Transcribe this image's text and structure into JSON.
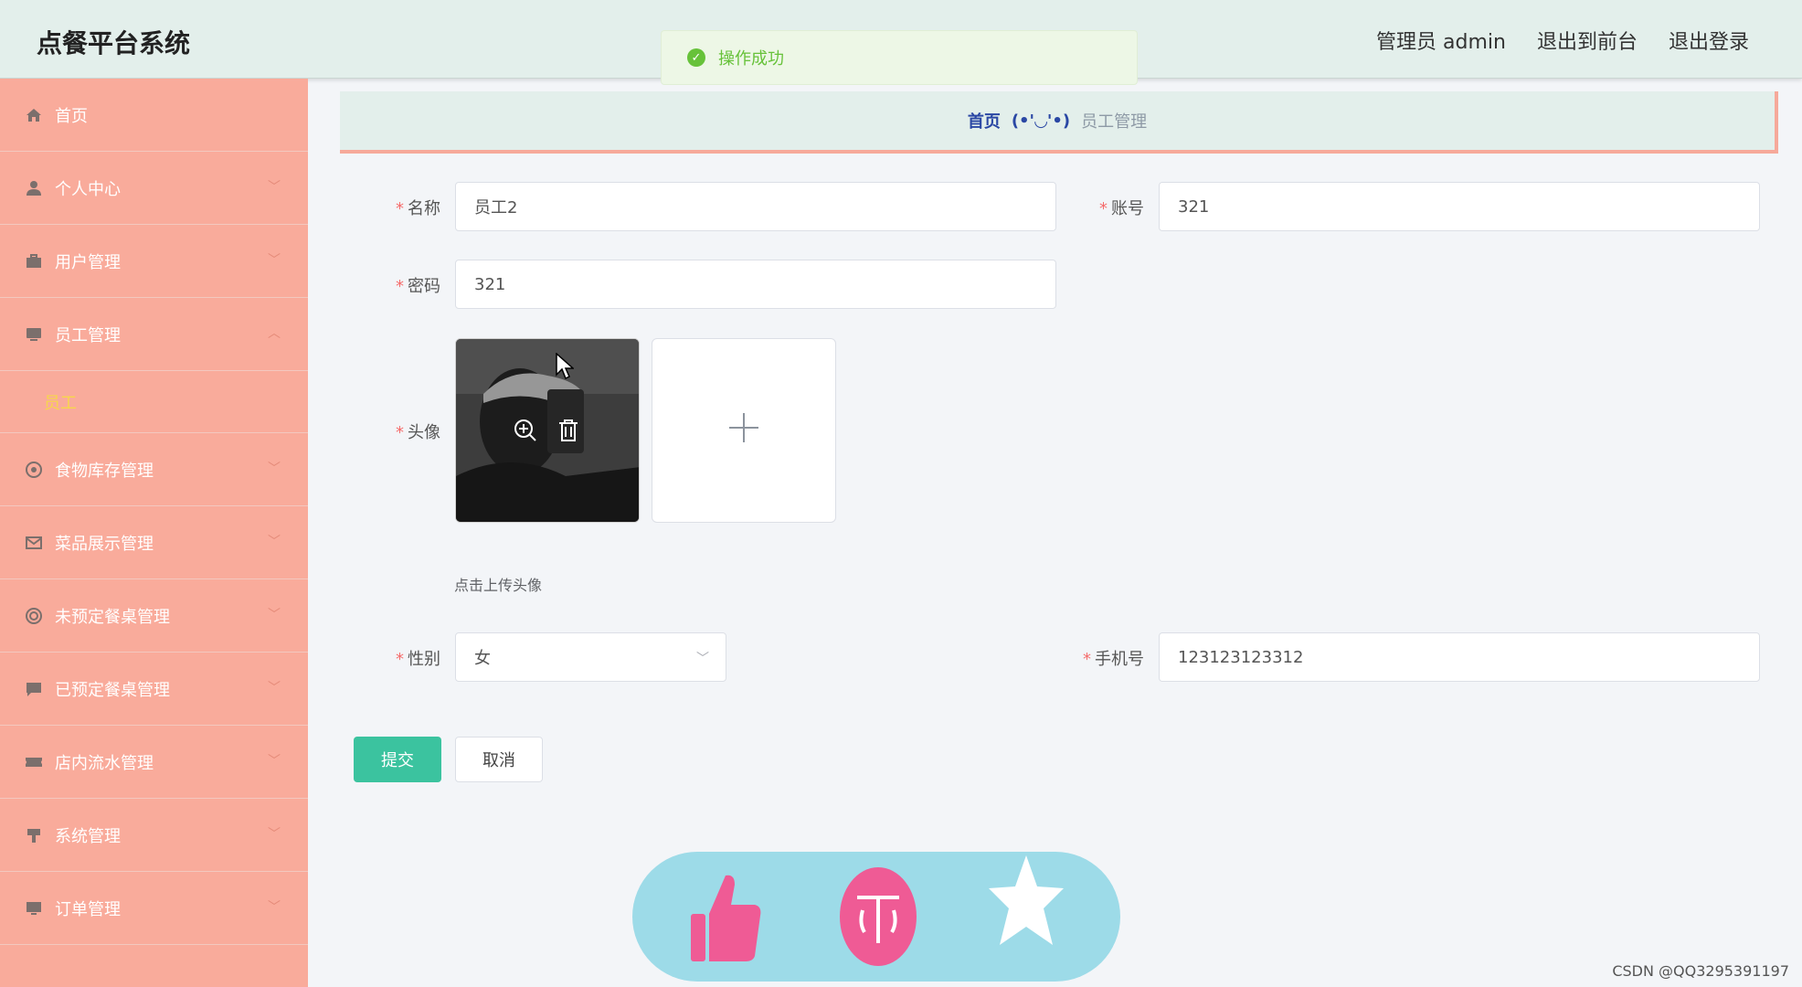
{
  "header": {
    "brand": "点餐平台系统",
    "user_label": "管理员 admin",
    "to_front": "退出到前台",
    "logout": "退出登录"
  },
  "toast": {
    "text": "操作成功"
  },
  "sidebar": {
    "items": [
      {
        "label": "首页",
        "icon": "home-icon"
      },
      {
        "label": "个人中心",
        "icon": "user-icon"
      },
      {
        "label": "用户管理",
        "icon": "briefcase-icon"
      },
      {
        "label": "员工管理",
        "icon": "monitor-icon",
        "expanded": true
      },
      {
        "label": "员工",
        "sub": true
      },
      {
        "label": "食物库存管理",
        "icon": "target-icon"
      },
      {
        "label": "菜品展示管理",
        "icon": "mail-icon"
      },
      {
        "label": "未预定餐桌管理",
        "icon": "lifebuoy-icon"
      },
      {
        "label": "已预定餐桌管理",
        "icon": "chat-icon"
      },
      {
        "label": "店内流水管理",
        "icon": "ticket-icon"
      },
      {
        "label": "系统管理",
        "icon": "podium-icon"
      },
      {
        "label": "订单管理",
        "icon": "desktop-icon"
      }
    ]
  },
  "breadcrumb": {
    "home": "首页",
    "separator": "(•'◡'•)",
    "current": "员工管理"
  },
  "form": {
    "name_label": "名称",
    "name_value": "员工2",
    "account_label": "账号",
    "account_value": "321",
    "password_label": "密码",
    "password_value": "321",
    "avatar_label": "头像",
    "upload_hint": "点击上传头像",
    "gender_label": "性别",
    "gender_value": "女",
    "phone_label": "手机号",
    "phone_value": "123123123312",
    "submit": "提交",
    "cancel": "取消"
  },
  "watermark": "CSDN @QQ3295391197",
  "colors": {
    "header_bg": "#e3efeb",
    "sidebar_bg": "#f9ab9b",
    "submit_bg": "#3bc39f",
    "submenu_active": "#f7d64c",
    "fab_bg": "#9ddbe8",
    "fab_pink": "#ef5b95"
  }
}
